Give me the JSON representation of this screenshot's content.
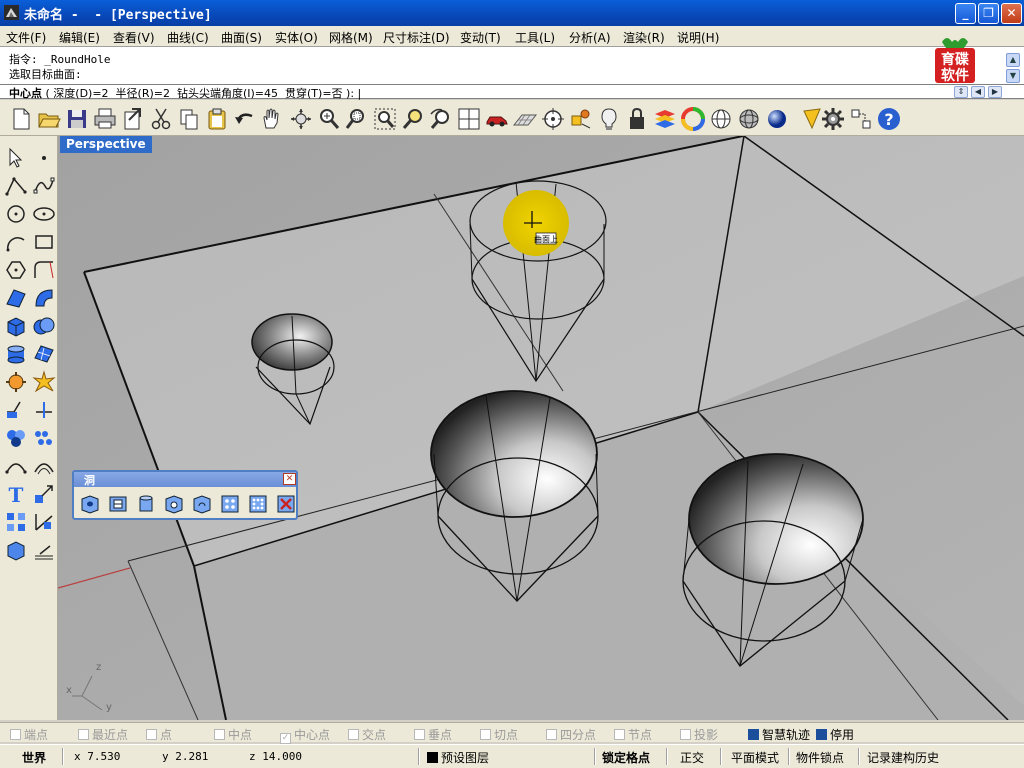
{
  "window": {
    "title": "未命名 -  - [Perspective]",
    "minimize_icon": "minimize-icon",
    "maximize_icon": "restore-icon",
    "close_icon": "close-icon"
  },
  "menu": [
    "文件(F)",
    "编辑(E)",
    "查看(V)",
    "曲线(C)",
    "曲面(S)",
    "实体(O)",
    "网格(M)",
    "尺寸标注(D)",
    "变动(T)",
    "工具(L)",
    "分析(A)",
    "渲染(R)",
    "说明(H)"
  ],
  "logo": {
    "line1": "育碟",
    "line2": "软件"
  },
  "command_history": [
    "指令: _RoundHole",
    "选取目标曲面:"
  ],
  "prompt": {
    "label": "中心点",
    "options": " ( 深度(D)=2  半径(R)=2  钻头尖端角度(I)=45  贯穿(T)=否 ): |"
  },
  "toolbar_icons": [
    "new-icon",
    "open-icon",
    "save-icon",
    "print-icon",
    "import-icon",
    "cut-icon",
    "copy-icon",
    "paste-icon",
    "undo-icon",
    "pan-icon",
    "rotate-view-icon",
    "zoom-window-icon",
    "zoom-dynamic-icon",
    "zoom-extents-icon",
    "zoom-selected-icon",
    "undo-view-icon",
    "four-viewports-icon",
    "car-icon",
    "grid-icon",
    "osnap-icon",
    "point-snap-icon",
    "light-icon",
    "lock-icon",
    "layers-icon",
    "color-wheel-icon",
    "wireframe-icon",
    "shaded-sphere-icon",
    "render-sphere-icon",
    "settings-gear-icon",
    "macro-icon",
    "help-icon"
  ],
  "viewport": {
    "label": "Perspective",
    "cursor_tag": "曲面上",
    "axis_labels": {
      "x": "x",
      "y": "y",
      "z": "z"
    }
  },
  "float_panel": {
    "title": "洞",
    "close_icon": "close-icon"
  },
  "osnaps": [
    {
      "label": "端点",
      "checked": false
    },
    {
      "label": "最近点",
      "checked": false
    },
    {
      "label": "点",
      "checked": false
    },
    {
      "label": "中点",
      "checked": false
    },
    {
      "label": "中心点",
      "checked": true
    },
    {
      "label": "交点",
      "checked": false
    },
    {
      "label": "垂点",
      "checked": false
    },
    {
      "label": "切点",
      "checked": false
    },
    {
      "label": "四分点",
      "checked": false
    },
    {
      "label": "节点",
      "checked": false
    },
    {
      "label": "投影",
      "checked": false
    },
    {
      "label": "智慧轨迹",
      "checked": true
    },
    {
      "label": "停用",
      "checked": true
    }
  ],
  "status": {
    "cplane": "世界",
    "x": "x 7.530",
    "y": "y 2.281",
    "z": "z 14.000",
    "layer": "预设图层",
    "snap": "锁定格点",
    "ortho": "正交",
    "planar": "平面模式",
    "osnap": "物件锁点",
    "history": "记录建构历史"
  },
  "colors": {
    "title_bar": "#0848b8",
    "viewport_bg": "#a9a9a9",
    "highlight": "#e6c700"
  }
}
